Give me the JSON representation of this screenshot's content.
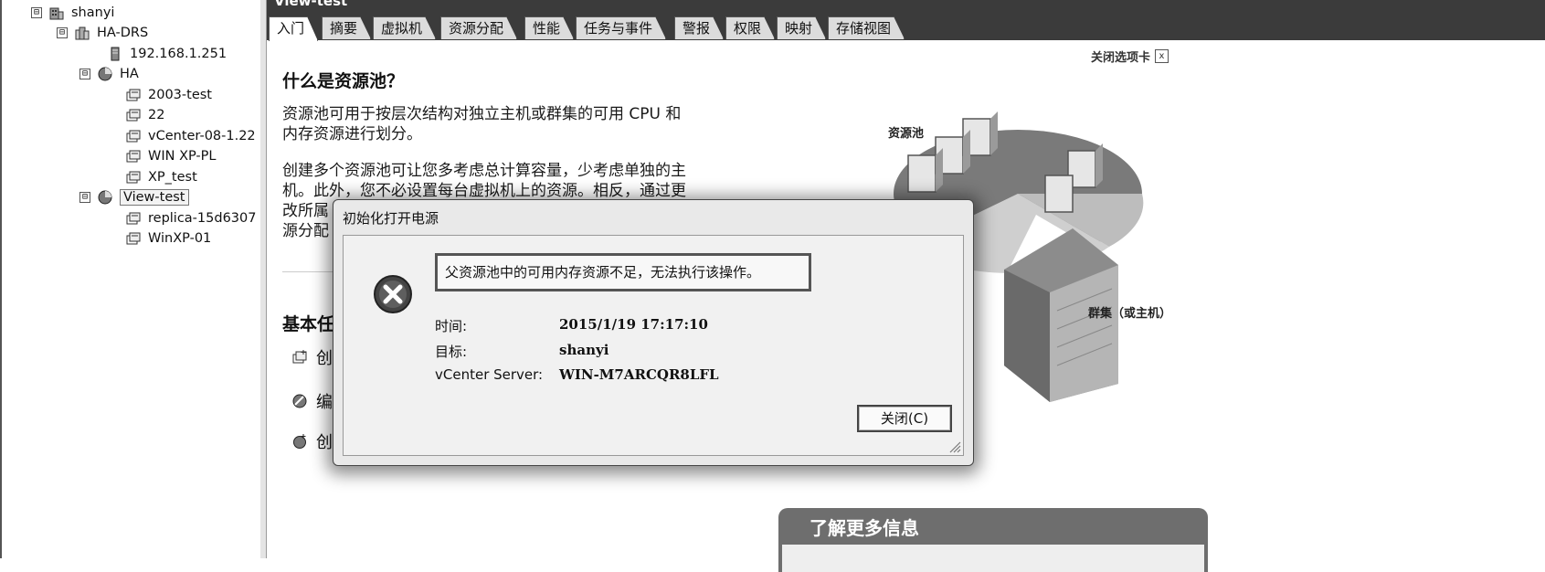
{
  "tree": {
    "items": [
      {
        "label": "shanyi",
        "icon": "datacenter-icon",
        "expander": "⊟"
      },
      {
        "label": "HA-DRS",
        "icon": "cluster-icon",
        "expander": "⊟"
      },
      {
        "label": "192.168.1.251",
        "icon": "host-icon"
      },
      {
        "label": "HA",
        "icon": "resource-pool-icon",
        "expander": "⊟"
      },
      {
        "label": "2003-test",
        "icon": "vm-icon"
      },
      {
        "label": "22",
        "icon": "vm-icon"
      },
      {
        "label": "vCenter-08-1.22",
        "icon": "vm-icon"
      },
      {
        "label": "WIN XP-PL",
        "icon": "vm-icon"
      },
      {
        "label": "XP_test",
        "icon": "vm-icon"
      },
      {
        "label": "View-test",
        "icon": "resource-pool-icon",
        "expander": "⊟",
        "selected": true
      },
      {
        "label": "replica-15d6307",
        "icon": "vm-icon"
      },
      {
        "label": "WinXP-01",
        "icon": "vm-icon"
      }
    ]
  },
  "main": {
    "title": "View-test",
    "tabs": [
      "入门",
      "摘要",
      "虚拟机",
      "资源分配",
      "性能",
      "任务与事件",
      "警报",
      "权限",
      "映射",
      "存储视图"
    ],
    "active_tab": 0,
    "close_tab_label": "关闭选项卡",
    "close_tab_x": "x",
    "heading": "什么是资源池？",
    "para1_l1": "资源池可用于按层次结构对独立主机或群集的可用 CPU 和",
    "para1_l2": "内存资源进行划分。",
    "para2_l1": "创建多个资源池可让您多考虑总计算容量，少考虑单独的主",
    "para2_l2": "机。此外，您不必设置每台虚拟机上的资源。相反，通过更",
    "para2_l3": "改所属",
    "para2_l4": "源分配",
    "basic_tasks_heading": "基本任",
    "tasks": [
      "创",
      "编",
      "创"
    ],
    "illus_label_pool": "资源池",
    "illus_label_cluster": "群集（或主机）",
    "learn_more": "了解更多信息"
  },
  "dialog": {
    "title": "初始化打开电源",
    "message": "父资源池中的可用内存资源不足，无法执行该操作。",
    "fields": [
      {
        "key": "时间:",
        "value": "2015/1/19 17:17:10"
      },
      {
        "key": "目标:",
        "value": "shanyi"
      },
      {
        "key": "vCenter Server:",
        "value": "WIN-M7ARCQR8LFL"
      }
    ],
    "close_button": "关闭(C)"
  }
}
